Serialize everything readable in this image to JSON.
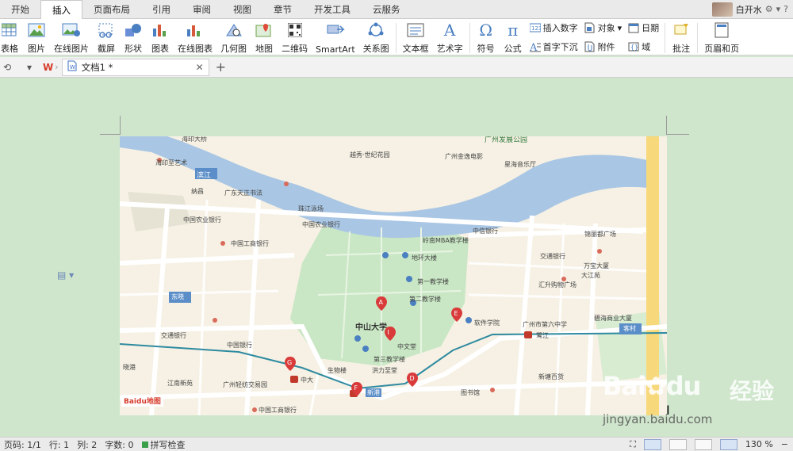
{
  "menubar": {
    "tabs": [
      "开始",
      "插入",
      "页面布局",
      "引用",
      "审阅",
      "视图",
      "章节",
      "开发工具",
      "云服务"
    ],
    "active_tab": "插入",
    "user_name": "白开水"
  },
  "ribbon": {
    "table": "表格",
    "picture": "图片",
    "online_picture": "在线图片",
    "screenshot": "截屏",
    "shapes": "形状",
    "chart": "图表",
    "online_chart": "在线图表",
    "geometry": "几何图",
    "map": "地图",
    "qrcode": "二维码",
    "smartart": "SmartArt",
    "relation": "关系图",
    "textbox": "文本框",
    "wordart": "艺术字",
    "symbol": "符号",
    "formula": "公式",
    "insert_number": "插入数字",
    "dropcap": "首字下沉",
    "object": "对象",
    "attachment": "附件",
    "date": "日期",
    "field": "域",
    "comment": "批注",
    "header_footer": "页眉和页"
  },
  "doctabs": {
    "doc_title": "文档1 *"
  },
  "map": {
    "labels": [
      "海印大桥",
      "广州发展公园",
      "滨江",
      "越秀·世纪花园",
      "广州金逸电影",
      "星海音乐厅",
      "海印至艺术",
      "纳昌",
      "广东天正书法",
      "珠江泳场",
      "中国农业银行",
      "中国工商银行",
      "中国农业银行",
      "中信银行",
      "交通银行",
      "锦丽都广场",
      "岭南MBA教学楼",
      "地环大楼",
      "第一教学楼",
      "中山大学",
      "软件学院",
      "广州市第六中学",
      "第二教学楼",
      "中文堂",
      "中国银行",
      "交通银行",
      "第三教学楼",
      "生物楼",
      "洪力至堂",
      "新港",
      "中大",
      "图书馆",
      "鹭江",
      "客村",
      "东晓",
      "晓港",
      "广州轻纺交易园",
      "中国工商银行",
      "江南新苑",
      "新塘百货",
      "汇升购物广场",
      "万宝大厦",
      "大江苑",
      "碧海商业大厦"
    ],
    "markers": [
      "A",
      "B",
      "C",
      "D",
      "E",
      "F",
      "G",
      "H",
      "I"
    ],
    "river_color": "#a9c6e4",
    "campus_color": "#c9e7c4",
    "road_color": "#ffffff",
    "major_road_color": "#f7d87a",
    "metro_color": "#2e8aa0",
    "marker_color": "#d93a3a",
    "logo_text": "Baidu地图"
  },
  "statusbar": {
    "pages": "页码: 1/1",
    "row": "行: 1",
    "col": "列: 2",
    "wordcount": "字数: 0",
    "spellcheck": "拼写检查",
    "zoom": "130 %"
  },
  "watermark": {
    "brand": "Bai",
    "paw": "du",
    "jingyan": "经验",
    "url": "jingyan.baidu.com"
  }
}
